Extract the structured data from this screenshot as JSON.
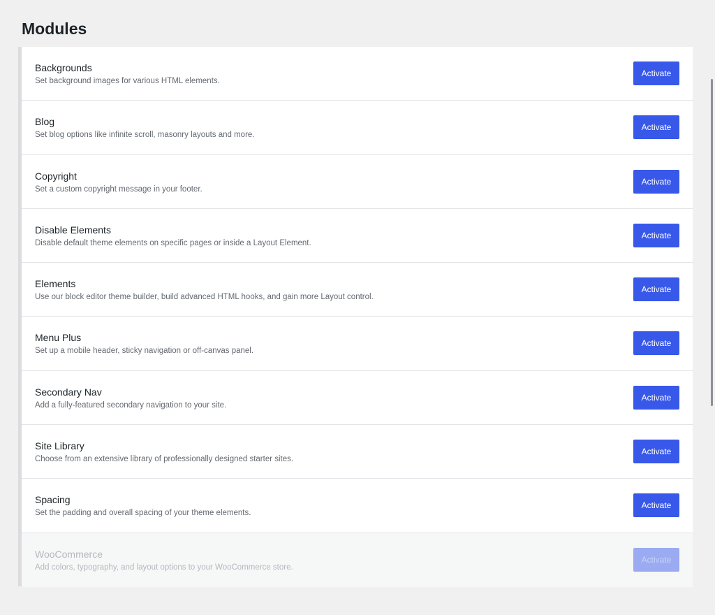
{
  "page": {
    "title": "Modules"
  },
  "modules": [
    {
      "name": "Backgrounds",
      "description": "Set background images for various HTML elements.",
      "button": "Activate",
      "enabled": true
    },
    {
      "name": "Blog",
      "description": "Set blog options like infinite scroll, masonry layouts and more.",
      "button": "Activate",
      "enabled": true
    },
    {
      "name": "Copyright",
      "description": "Set a custom copyright message in your footer.",
      "button": "Activate",
      "enabled": true
    },
    {
      "name": "Disable Elements",
      "description": "Disable default theme elements on specific pages or inside a Layout Element.",
      "button": "Activate",
      "enabled": true
    },
    {
      "name": "Elements",
      "description": "Use our block editor theme builder, build advanced HTML hooks, and gain more Layout control.",
      "button": "Activate",
      "enabled": true
    },
    {
      "name": "Menu Plus",
      "description": "Set up a mobile header, sticky navigation or off-canvas panel.",
      "button": "Activate",
      "enabled": true
    },
    {
      "name": "Secondary Nav",
      "description": "Add a fully-featured secondary navigation to your site.",
      "button": "Activate",
      "enabled": true
    },
    {
      "name": "Site Library",
      "description": "Choose from an extensive library of professionally designed starter sites.",
      "button": "Activate",
      "enabled": true
    },
    {
      "name": "Spacing",
      "description": "Set the padding and overall spacing of your theme elements.",
      "button": "Activate",
      "enabled": true
    },
    {
      "name": "WooCommerce",
      "description": "Add colors, typography, and layout options to your WooCommerce store.",
      "button": "Activate",
      "enabled": false
    }
  ],
  "colors": {
    "accent": "#3858e9",
    "background": "#f0f0f1",
    "panel": "#ffffff"
  }
}
